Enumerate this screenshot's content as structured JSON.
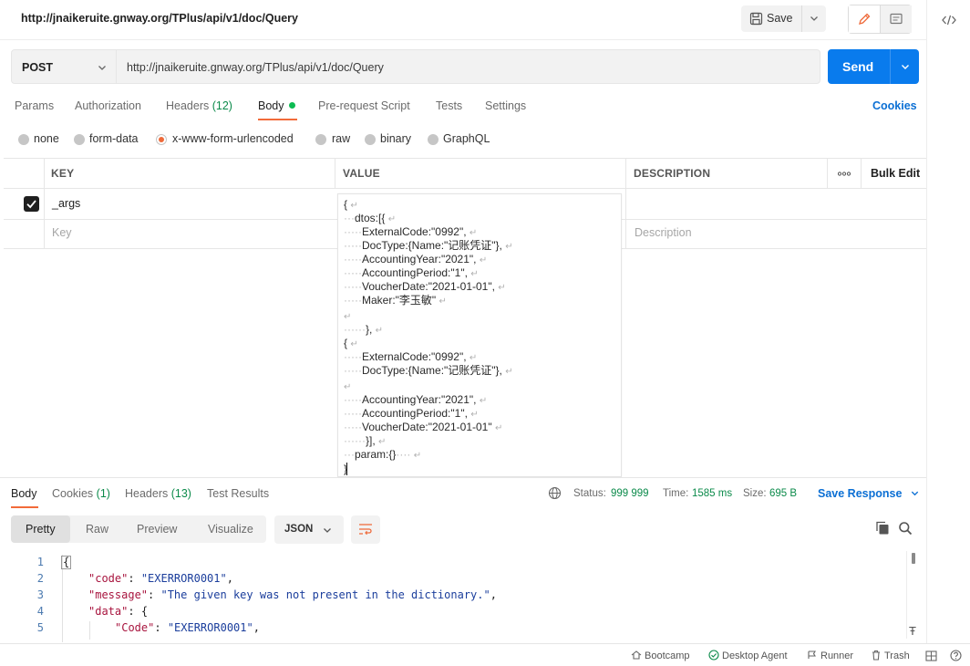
{
  "header": {
    "request_title": "http://jnaikeruite.gnway.org/TPlus/api/v1/doc/Query",
    "save_label": "Save"
  },
  "url_bar": {
    "method": "POST",
    "url": "http://jnaikeruite.gnway.org/TPlus/api/v1/doc/Query",
    "send_label": "Send"
  },
  "request_tabs": {
    "params": "Params",
    "authorization": "Authorization",
    "headers": "Headers",
    "headers_count": "(12)",
    "body": "Body",
    "pre_request": "Pre-request Script",
    "tests": "Tests",
    "settings": "Settings",
    "cookies": "Cookies"
  },
  "body_types": {
    "none": "none",
    "form_data": "form-data",
    "urlencoded": "x-www-form-urlencoded",
    "raw": "raw",
    "binary": "binary",
    "graphql": "GraphQL",
    "selected": "x-www-form-urlencoded"
  },
  "kv_table": {
    "col_key": "KEY",
    "col_value": "VALUE",
    "col_description": "DESCRIPTION",
    "bulk_edit": "Bulk Edit",
    "row_key": "_args",
    "key_placeholder": "Key",
    "description_placeholder": "Description"
  },
  "value_lines": {
    "l1": "{",
    "l2": "dtos:[{",
    "l3": "ExternalCode:\"0992\",",
    "l4": "DocType:{Name:\"记账凭证\"},",
    "l5": "AccountingYear:\"2021\",",
    "l6": "AccountingPeriod:\"1\",",
    "l7": "VoucherDate:\"2021-01-01\",",
    "l8": "Maker:\"李玉敏\"",
    "l10": "},",
    "l11": "{",
    "l12": "ExternalCode:\"0992\",",
    "l13": "DocType:{Name:\"记账凭证\"},",
    "l15": "AccountingYear:\"2021\",",
    "l16": "AccountingPeriod:\"1\",",
    "l17": "VoucherDate:\"2021-01-01\"",
    "l18": "}],",
    "l19": "param:{}",
    "l20": "}"
  },
  "response_tabs": {
    "body": "Body",
    "cookies": "Cookies",
    "cookies_count": "(1)",
    "headers": "Headers",
    "headers_count": "(13)",
    "test_results": "Test Results"
  },
  "response_status": {
    "status_label": "Status:",
    "status_value": "999 999",
    "time_label": "Time:",
    "time_value": "1585 ms",
    "size_label": "Size:",
    "size_value": "695 B",
    "save_response": "Save Response"
  },
  "view_modes": {
    "pretty": "Pretty",
    "raw": "Raw",
    "preview": "Preview",
    "visualize": "Visualize",
    "format": "JSON"
  },
  "response_body": {
    "line_numbers": [
      "1",
      "2",
      "3",
      "4",
      "5"
    ],
    "brace_open": "{",
    "code_key": "\"code\"",
    "code_val": "\"EXERROR0001\"",
    "message_key": "\"message\"",
    "message_val": "\"The given key was not present in the dictionary.\"",
    "data_key": "\"data\"",
    "data_open": "{",
    "inner_code_key": "\"Code\"",
    "inner_code_val": "\"EXERROR0001\""
  },
  "footer": {
    "bootcamp": "Bootcamp",
    "desktop_agent": "Desktop Agent",
    "runner": "Runner",
    "trash": "Trash"
  },
  "colors": {
    "accent_blue": "#097bed",
    "link_blue": "#0b6fd4",
    "active_orange": "#f26b3a",
    "success_green": "#0b8a4a",
    "json_key": "#a8143e",
    "json_string": "#1b3e9c"
  }
}
